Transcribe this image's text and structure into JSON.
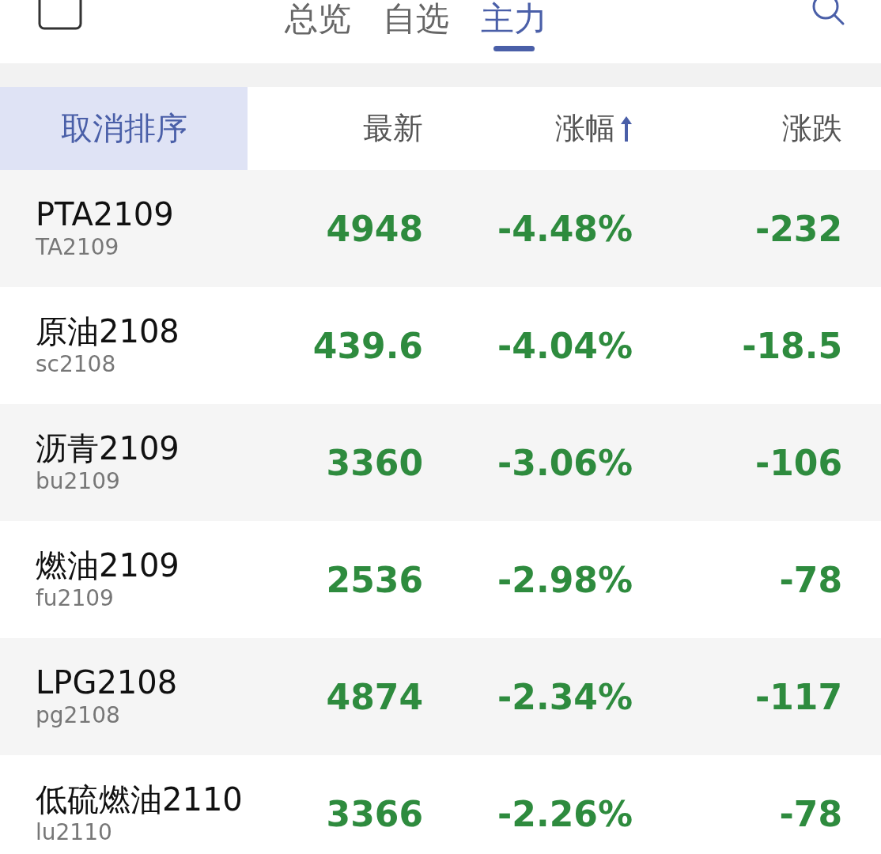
{
  "tabs": [
    {
      "label": "总览",
      "selected": false
    },
    {
      "label": "自选",
      "selected": false
    },
    {
      "label": "主力",
      "selected": true
    }
  ],
  "header": {
    "reset_button": "取消排序",
    "columns": [
      {
        "label": "最新",
        "sorted": false
      },
      {
        "label": "涨幅",
        "sorted": true,
        "ascending": true
      },
      {
        "label": "涨跌",
        "sorted": false
      }
    ]
  },
  "rows": [
    {
      "name": "PTA2109",
      "code": "TA2109",
      "latest": "4948",
      "change_pct": "-4.48%",
      "change": "-232"
    },
    {
      "name": "原油2108",
      "code": "sc2108",
      "latest": "439.6",
      "change_pct": "-4.04%",
      "change": "-18.5"
    },
    {
      "name": "沥青2109",
      "code": "bu2109",
      "latest": "3360",
      "change_pct": "-3.06%",
      "change": "-106"
    },
    {
      "name": "燃油2109",
      "code": "fu2109",
      "latest": "2536",
      "change_pct": "-2.98%",
      "change": "-78"
    },
    {
      "name": "LPG2108",
      "code": "pg2108",
      "latest": "4874",
      "change_pct": "-2.34%",
      "change": "-117"
    },
    {
      "name": "低硫燃油2110",
      "code": "lu2110",
      "latest": "3366",
      "change_pct": "-2.26%",
      "change": "-78"
    }
  ]
}
